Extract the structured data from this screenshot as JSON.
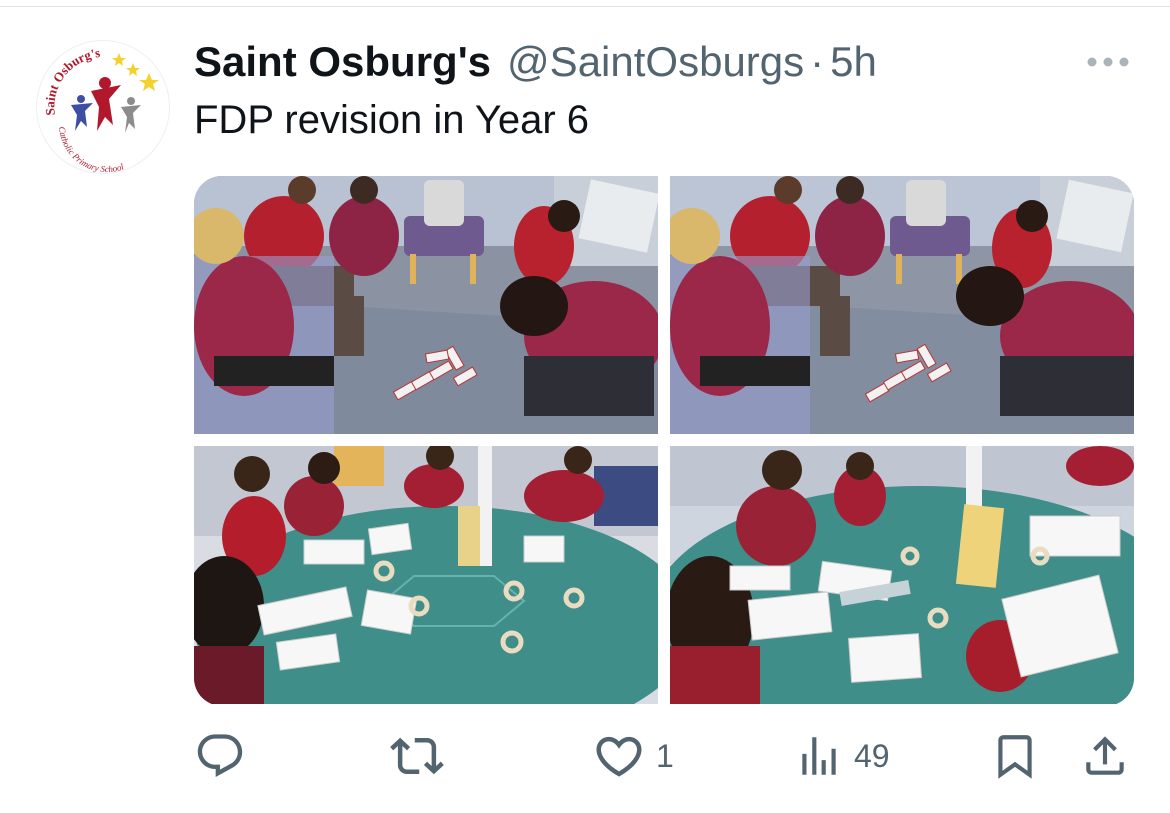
{
  "tweet": {
    "display_name": "Saint Osburg's",
    "handle": "@SaintOsburgs",
    "separator": "·",
    "time": "5h",
    "text": "FDP revision in Year 6"
  },
  "avatar": {
    "logo_top_text": "Saint Osburg's",
    "logo_bottom_text": "Catholic Primary School",
    "colors": {
      "red": "#b2182b",
      "blue": "#3e4fa3",
      "grey": "#8c8c8c",
      "star": "#f5d12a"
    }
  },
  "media": {
    "photos": [
      {
        "scene": "classroom-floor-dominoes"
      },
      {
        "scene": "classroom-floor-dominoes"
      },
      {
        "scene": "round-table-worksheets"
      },
      {
        "scene": "round-table-worksheets-closeup"
      }
    ]
  },
  "actions": {
    "reply": {
      "icon": "reply-icon",
      "count": ""
    },
    "retweet": {
      "icon": "retweet-icon",
      "count": ""
    },
    "like": {
      "icon": "heart-icon",
      "count": "1"
    },
    "views": {
      "icon": "views-icon",
      "count": "49"
    },
    "bookmark": {
      "icon": "bookmark-icon"
    },
    "share": {
      "icon": "share-icon"
    }
  },
  "colors": {
    "text": "#0f1419",
    "secondary": "#536471",
    "divider": "#e1e4e7"
  }
}
